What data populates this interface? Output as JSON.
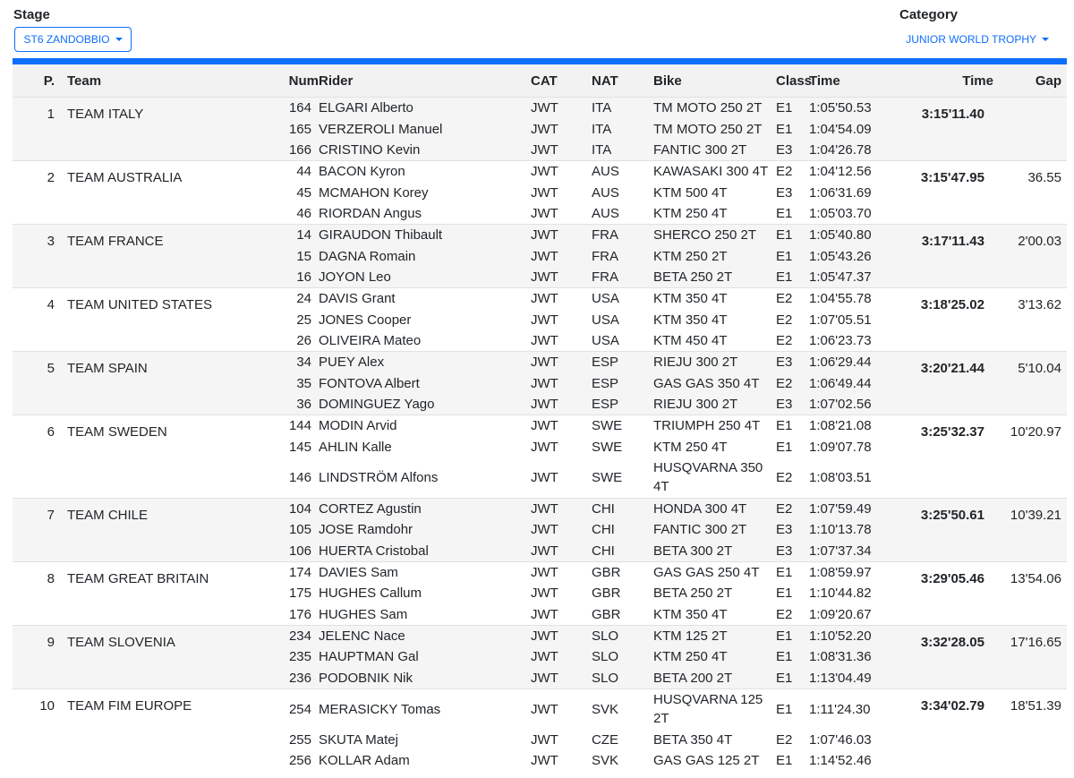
{
  "filters": {
    "stage_label": "Stage",
    "stage_value": "ST6 ZANDOBBIO",
    "category_label": "Category",
    "category_value": "JUNIOR WORLD TROPHY"
  },
  "colors": {
    "accent": "#0d6efd",
    "row_shade": "#f5f5f5"
  },
  "table": {
    "headers": {
      "pos": "P.",
      "team": "Team",
      "num": "Num",
      "rider": "Rider",
      "cat": "CAT",
      "nat": "NAT",
      "bike": "Bike",
      "class": "Class",
      "rider_time": "Time",
      "time": "Time",
      "gap": "Gap"
    },
    "teams": [
      {
        "pos": "1",
        "team": "TEAM ITALY",
        "time": "3:15'11.40",
        "gap": "",
        "riders": [
          {
            "num": "164",
            "name": "ELGARI Alberto",
            "cat": "JWT",
            "nat": "ITA",
            "bike": "TM MOTO 250 2T",
            "class": "E1",
            "time": "1:05'50.53"
          },
          {
            "num": "165",
            "name": "VERZEROLI Manuel",
            "cat": "JWT",
            "nat": "ITA",
            "bike": "TM MOTO 250 2T",
            "class": "E1",
            "time": "1:04'54.09"
          },
          {
            "num": "166",
            "name": "CRISTINO Kevin",
            "cat": "JWT",
            "nat": "ITA",
            "bike": "FANTIC 300 2T",
            "class": "E3",
            "time": "1:04'26.78"
          }
        ]
      },
      {
        "pos": "2",
        "team": "TEAM AUSTRALIA",
        "time": "3:15'47.95",
        "gap": "36.55",
        "riders": [
          {
            "num": "44",
            "name": "BACON Kyron",
            "cat": "JWT",
            "nat": "AUS",
            "bike": "KAWASAKI 300 4T",
            "class": "E2",
            "time": "1:04'12.56"
          },
          {
            "num": "45",
            "name": "MCMAHON Korey",
            "cat": "JWT",
            "nat": "AUS",
            "bike": "KTM 500 4T",
            "class": "E3",
            "time": "1:06'31.69"
          },
          {
            "num": "46",
            "name": "RIORDAN Angus",
            "cat": "JWT",
            "nat": "AUS",
            "bike": "KTM 250 4T",
            "class": "E1",
            "time": "1:05'03.70"
          }
        ]
      },
      {
        "pos": "3",
        "team": "TEAM FRANCE",
        "time": "3:17'11.43",
        "gap": "2'00.03",
        "riders": [
          {
            "num": "14",
            "name": "GIRAUDON Thibault",
            "cat": "JWT",
            "nat": "FRA",
            "bike": "SHERCO 250 2T",
            "class": "E1",
            "time": "1:05'40.80"
          },
          {
            "num": "15",
            "name": "DAGNA Romain",
            "cat": "JWT",
            "nat": "FRA",
            "bike": "KTM 250 2T",
            "class": "E1",
            "time": "1:05'43.26"
          },
          {
            "num": "16",
            "name": "JOYON Leo",
            "cat": "JWT",
            "nat": "FRA",
            "bike": "BETA 250 2T",
            "class": "E1",
            "time": "1:05'47.37"
          }
        ]
      },
      {
        "pos": "4",
        "team": "TEAM UNITED STATES",
        "time": "3:18'25.02",
        "gap": "3'13.62",
        "riders": [
          {
            "num": "24",
            "name": "DAVIS Grant",
            "cat": "JWT",
            "nat": "USA",
            "bike": "KTM 350 4T",
            "class": "E2",
            "time": "1:04'55.78"
          },
          {
            "num": "25",
            "name": "JONES Cooper",
            "cat": "JWT",
            "nat": "USA",
            "bike": "KTM 350 4T",
            "class": "E2",
            "time": "1:07'05.51"
          },
          {
            "num": "26",
            "name": "OLIVEIRA Mateo",
            "cat": "JWT",
            "nat": "USA",
            "bike": "KTM 450 4T",
            "class": "E2",
            "time": "1:06'23.73"
          }
        ]
      },
      {
        "pos": "5",
        "team": "TEAM SPAIN",
        "time": "3:20'21.44",
        "gap": "5'10.04",
        "riders": [
          {
            "num": "34",
            "name": "PUEY Alex",
            "cat": "JWT",
            "nat": "ESP",
            "bike": "RIEJU 300 2T",
            "class": "E3",
            "time": "1:06'29.44"
          },
          {
            "num": "35",
            "name": "FONTOVA Albert",
            "cat": "JWT",
            "nat": "ESP",
            "bike": "GAS GAS 350 4T",
            "class": "E2",
            "time": "1:06'49.44"
          },
          {
            "num": "36",
            "name": "DOMINGUEZ Yago",
            "cat": "JWT",
            "nat": "ESP",
            "bike": "RIEJU 300 2T",
            "class": "E3",
            "time": "1:07'02.56"
          }
        ]
      },
      {
        "pos": "6",
        "team": "TEAM SWEDEN",
        "time": "3:25'32.37",
        "gap": "10'20.97",
        "riders": [
          {
            "num": "144",
            "name": "MODIN Arvid",
            "cat": "JWT",
            "nat": "SWE",
            "bike": "TRIUMPH 250 4T",
            "class": "E1",
            "time": "1:08'21.08"
          },
          {
            "num": "145",
            "name": "AHLIN Kalle",
            "cat": "JWT",
            "nat": "SWE",
            "bike": "KTM 250 4T",
            "class": "E1",
            "time": "1:09'07.78"
          },
          {
            "num": "146",
            "name": "LINDSTRÖM Alfons",
            "cat": "JWT",
            "nat": "SWE",
            "bike": "HUSQVARNA 350 4T",
            "class": "E2",
            "time": "1:08'03.51"
          }
        ]
      },
      {
        "pos": "7",
        "team": "TEAM CHILE",
        "time": "3:25'50.61",
        "gap": "10'39.21",
        "riders": [
          {
            "num": "104",
            "name": "CORTEZ Agustin",
            "cat": "JWT",
            "nat": "CHI",
            "bike": "HONDA 300 4T",
            "class": "E2",
            "time": "1:07'59.49"
          },
          {
            "num": "105",
            "name": "JOSE Ramdohr",
            "cat": "JWT",
            "nat": "CHI",
            "bike": "FANTIC 300 2T",
            "class": "E3",
            "time": "1:10'13.78"
          },
          {
            "num": "106",
            "name": "HUERTA Cristobal",
            "cat": "JWT",
            "nat": "CHI",
            "bike": "BETA 300 2T",
            "class": "E3",
            "time": "1:07'37.34"
          }
        ]
      },
      {
        "pos": "8",
        "team": "TEAM GREAT BRITAIN",
        "time": "3:29'05.46",
        "gap": "13'54.06",
        "riders": [
          {
            "num": "174",
            "name": "DAVIES Sam",
            "cat": "JWT",
            "nat": "GBR",
            "bike": "GAS GAS 250 4T",
            "class": "E1",
            "time": "1:08'59.97"
          },
          {
            "num": "175",
            "name": "HUGHES Callum",
            "cat": "JWT",
            "nat": "GBR",
            "bike": "BETA 250 2T",
            "class": "E1",
            "time": "1:10'44.82"
          },
          {
            "num": "176",
            "name": "HUGHES Sam",
            "cat": "JWT",
            "nat": "GBR",
            "bike": "KTM 350 4T",
            "class": "E2",
            "time": "1:09'20.67"
          }
        ]
      },
      {
        "pos": "9",
        "team": "TEAM SLOVENIA",
        "time": "3:32'28.05",
        "gap": "17'16.65",
        "riders": [
          {
            "num": "234",
            "name": "JELENC Nace",
            "cat": "JWT",
            "nat": "SLO",
            "bike": "KTM 125 2T",
            "class": "E1",
            "time": "1:10'52.20"
          },
          {
            "num": "235",
            "name": "HAUPTMAN Gal",
            "cat": "JWT",
            "nat": "SLO",
            "bike": "KTM 250 4T",
            "class": "E1",
            "time": "1:08'31.36"
          },
          {
            "num": "236",
            "name": "PODOBNIK Nik",
            "cat": "JWT",
            "nat": "SLO",
            "bike": "BETA 200 2T",
            "class": "E1",
            "time": "1:13'04.49"
          }
        ]
      },
      {
        "pos": "10",
        "team": "TEAM FIM EUROPE",
        "time": "3:34'02.79",
        "gap": "18'51.39",
        "riders": [
          {
            "num": "254",
            "name": "MERASICKY Tomas",
            "cat": "JWT",
            "nat": "SVK",
            "bike": "HUSQVARNA 125 2T",
            "class": "E1",
            "time": "1:11'24.30"
          },
          {
            "num": "255",
            "name": "SKUTA Matej",
            "cat": "JWT",
            "nat": "CZE",
            "bike": "BETA 350 4T",
            "class": "E2",
            "time": "1:07'46.03"
          },
          {
            "num": "256",
            "name": "KOLLAR Adam",
            "cat": "JWT",
            "nat": "SVK",
            "bike": "GAS GAS 125 2T",
            "class": "E1",
            "time": "1:14'52.46"
          }
        ]
      }
    ]
  }
}
